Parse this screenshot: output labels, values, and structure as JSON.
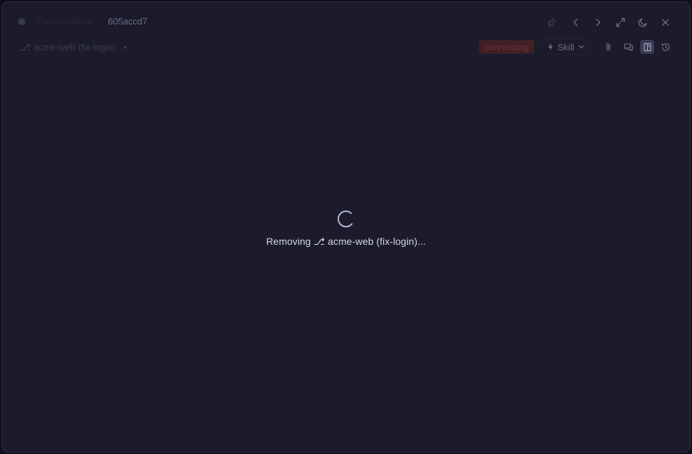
{
  "window": {
    "title_prefix": "Conversation",
    "session_id": "605accd7"
  },
  "titlebar_icons": [
    "pin-icon",
    "back-icon",
    "forward-icon",
    "expand-icon",
    "theme-moon-icon",
    "close-icon"
  ],
  "toolbar": {
    "branch_label": "⎇ acme-web (fix-login)",
    "branch_caret": "▼",
    "status": "connecting",
    "skill_label": "Skill",
    "icons": [
      "attach-icon",
      "chat-icon",
      "panel-icon",
      "history-icon"
    ]
  },
  "loading": {
    "message": "Removing ⎇ acme-web (fix-login)..."
  },
  "colors": {
    "background": "#1b1b2b",
    "status_bg": "#3f2025",
    "status_text": "#73303a",
    "loading_text": "#d6d6ec"
  }
}
